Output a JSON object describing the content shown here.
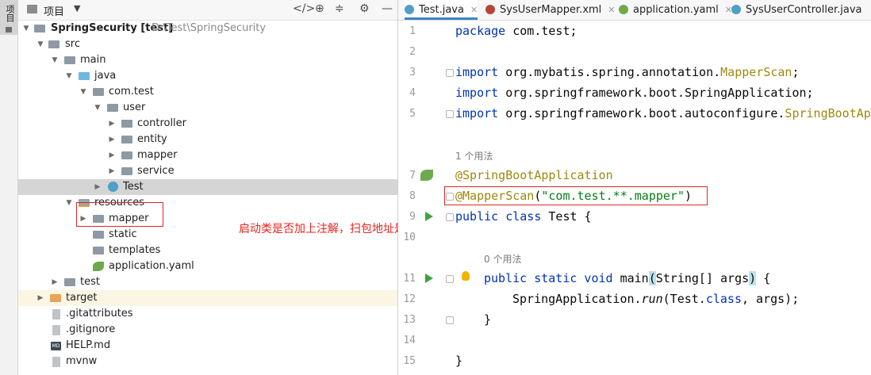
{
  "side_strip": {
    "label": "项目"
  },
  "project_panel": {
    "title": "项目",
    "tree": [
      {
        "label": "SpringSecurity [test]",
        "path": "D:\\Test\\SpringSecurity"
      },
      {
        "label": "src"
      },
      {
        "label": "main"
      },
      {
        "label": "java"
      },
      {
        "label": "com.test"
      },
      {
        "label": "user"
      },
      {
        "label": "controller"
      },
      {
        "label": "entity"
      },
      {
        "label": "mapper"
      },
      {
        "label": "service"
      },
      {
        "label": "Test"
      },
      {
        "label": "resources"
      },
      {
        "label": "mapper"
      },
      {
        "label": "static"
      },
      {
        "label": "templates"
      },
      {
        "label": "application.yaml"
      },
      {
        "label": "test"
      },
      {
        "label": "target"
      },
      {
        "label": ".gitattributes"
      },
      {
        "label": ".gitignore"
      },
      {
        "label": "HELP.md"
      },
      {
        "label": "mvnw"
      }
    ]
  },
  "annotation_note": "启动类是否加上注解，扫包地址是否正确",
  "editor": {
    "tabs": [
      {
        "label": "Test.java",
        "color": "#4fa0c8"
      },
      {
        "label": "SysUserMapper.xml",
        "color": "#b5453a"
      },
      {
        "label": "application.yaml",
        "color": "#6fa94d"
      },
      {
        "label": "SysUserController.java",
        "color": "#4fa0c8"
      }
    ],
    "line_numbers": [
      "1",
      "2",
      "3",
      "4",
      "5",
      "7",
      "8",
      "9",
      "10",
      "11",
      "12",
      "13",
      "14",
      "15"
    ],
    "usage_hints": [
      "1 个用法",
      "0 个用法"
    ],
    "lines": {
      "l1_kw": "package",
      "l1_rest": " com.test;",
      "l3_kw": "import",
      "l3_a": " org.mybatis.spring.annotation.",
      "l3_b": "MapperScan",
      "l3_c": ";",
      "l4_kw": "import",
      "l4_a": " org.springframework.boot.SpringApplication;",
      "l5_kw": "import",
      "l5_a": " org.springframework.boot.autoconfigure.",
      "l5_b": "SpringBootApplication;",
      "l7": "@SpringBootApplication",
      "l8_an": "@MapperScan",
      "l8_open": "(",
      "l8_str": "\"com.test.**.mapper\"",
      "l8_close": ")",
      "l9_kw": "public class",
      "l9_rest": " Test {",
      "l11_kw": "public static void",
      "l11_name": " main",
      "l11_args": "String[] args",
      "l11_end": " {",
      "l12_a": "SpringApplication.",
      "l12_run": "run",
      "l12_b": "(Test.",
      "l12_kw": "class",
      "l12_c": ", args);",
      "l13": "}",
      "l15": "}"
    }
  },
  "colors": {
    "accent": "#4083c9",
    "highlight_box": "#d82a2a",
    "keyword": "#0033b3",
    "annotation": "#9e880d",
    "string": "#067d17"
  }
}
